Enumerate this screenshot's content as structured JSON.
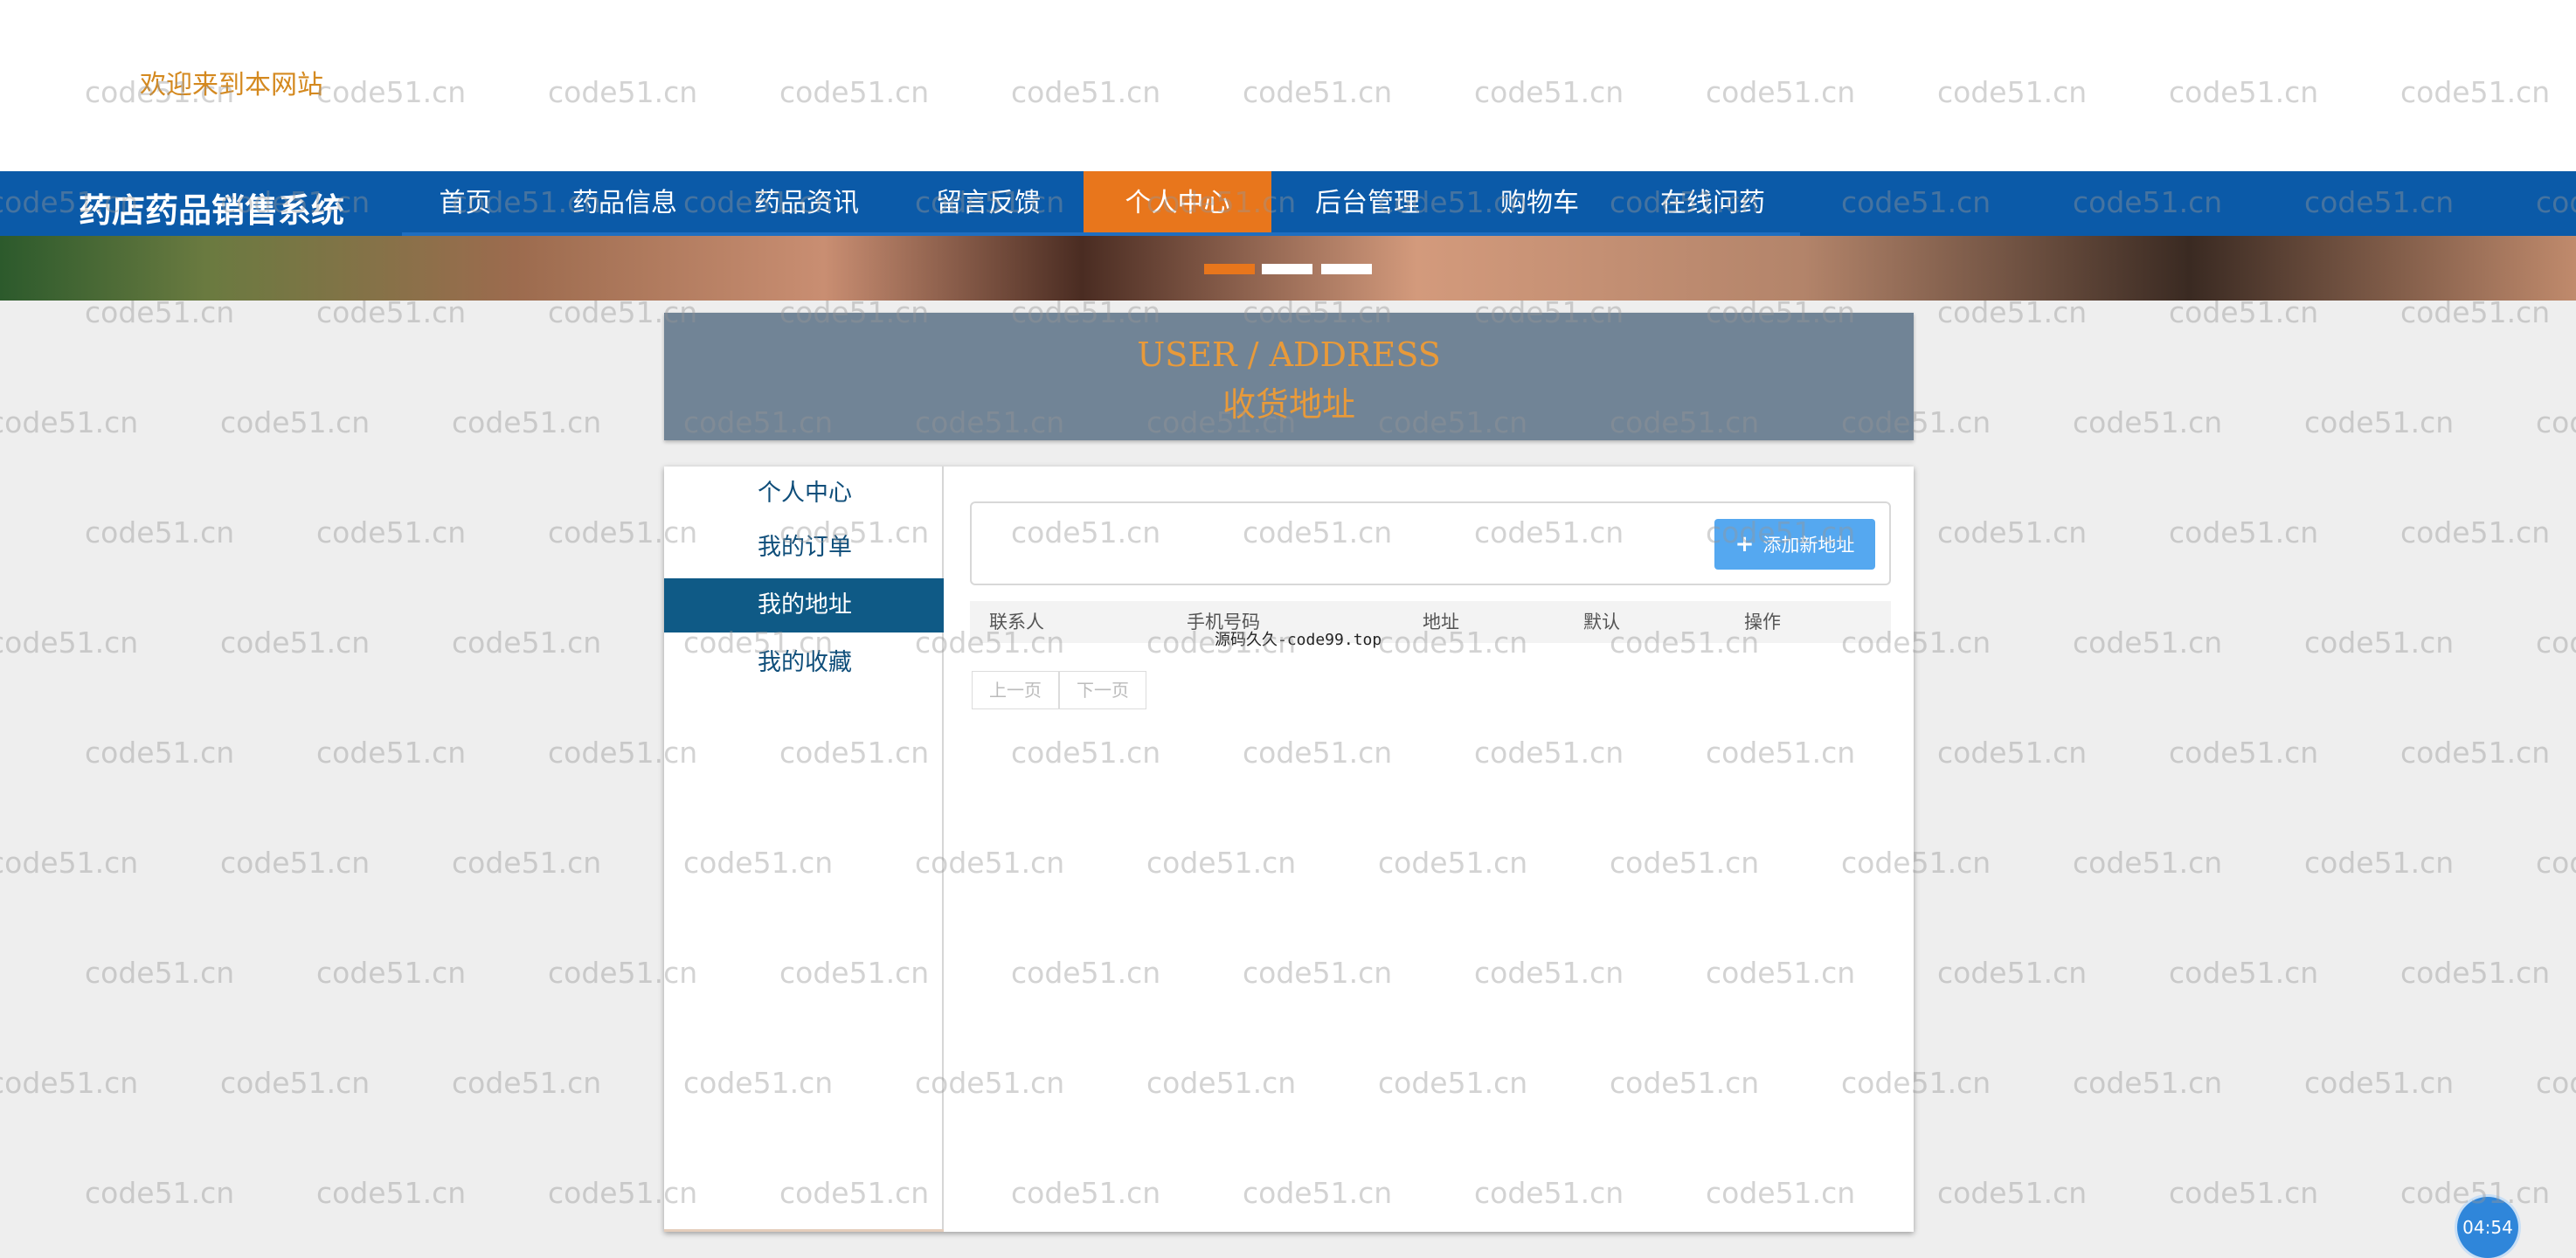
{
  "header": {
    "welcome": "欢迎来到本网站"
  },
  "nav": {
    "brand": "药店药品销售系统",
    "items": [
      {
        "label": "首页",
        "active": false
      },
      {
        "label": "药品信息",
        "active": false
      },
      {
        "label": "药品资讯",
        "active": false
      },
      {
        "label": "留言反馈",
        "active": false
      },
      {
        "label": "个人中心",
        "active": true
      },
      {
        "label": "后台管理",
        "active": false
      },
      {
        "label": "购物车",
        "active": false
      },
      {
        "label": "在线问药",
        "active": false
      }
    ]
  },
  "banner": {
    "active_slide": 1,
    "slide_count": 3
  },
  "page_title": {
    "en": "USER / ADDRESS",
    "cn": "收货地址"
  },
  "sidebar": {
    "items": [
      {
        "label": "个人中心",
        "active": false
      },
      {
        "label": "我的订单",
        "active": false
      },
      {
        "label": "我的地址",
        "active": true
      },
      {
        "label": "我的收藏",
        "active": false
      }
    ]
  },
  "toolbar": {
    "add_label": "添加新地址"
  },
  "table": {
    "columns": [
      "联系人",
      "手机号码",
      "地址",
      "默认",
      "操作"
    ],
    "rows": []
  },
  "pager": {
    "prev": "上一页",
    "next": "下一页"
  },
  "promo_text": "源码久久-code99.top",
  "watermark_text": "code51.cn",
  "timer": "04:54",
  "colors": {
    "nav_bg": "#0b5aa8",
    "accent": "#e8761c",
    "title_bg": "#718496",
    "title_text": "#e89a3a",
    "sidebar_active": "#0f5a86",
    "button": "#55a8f0"
  }
}
